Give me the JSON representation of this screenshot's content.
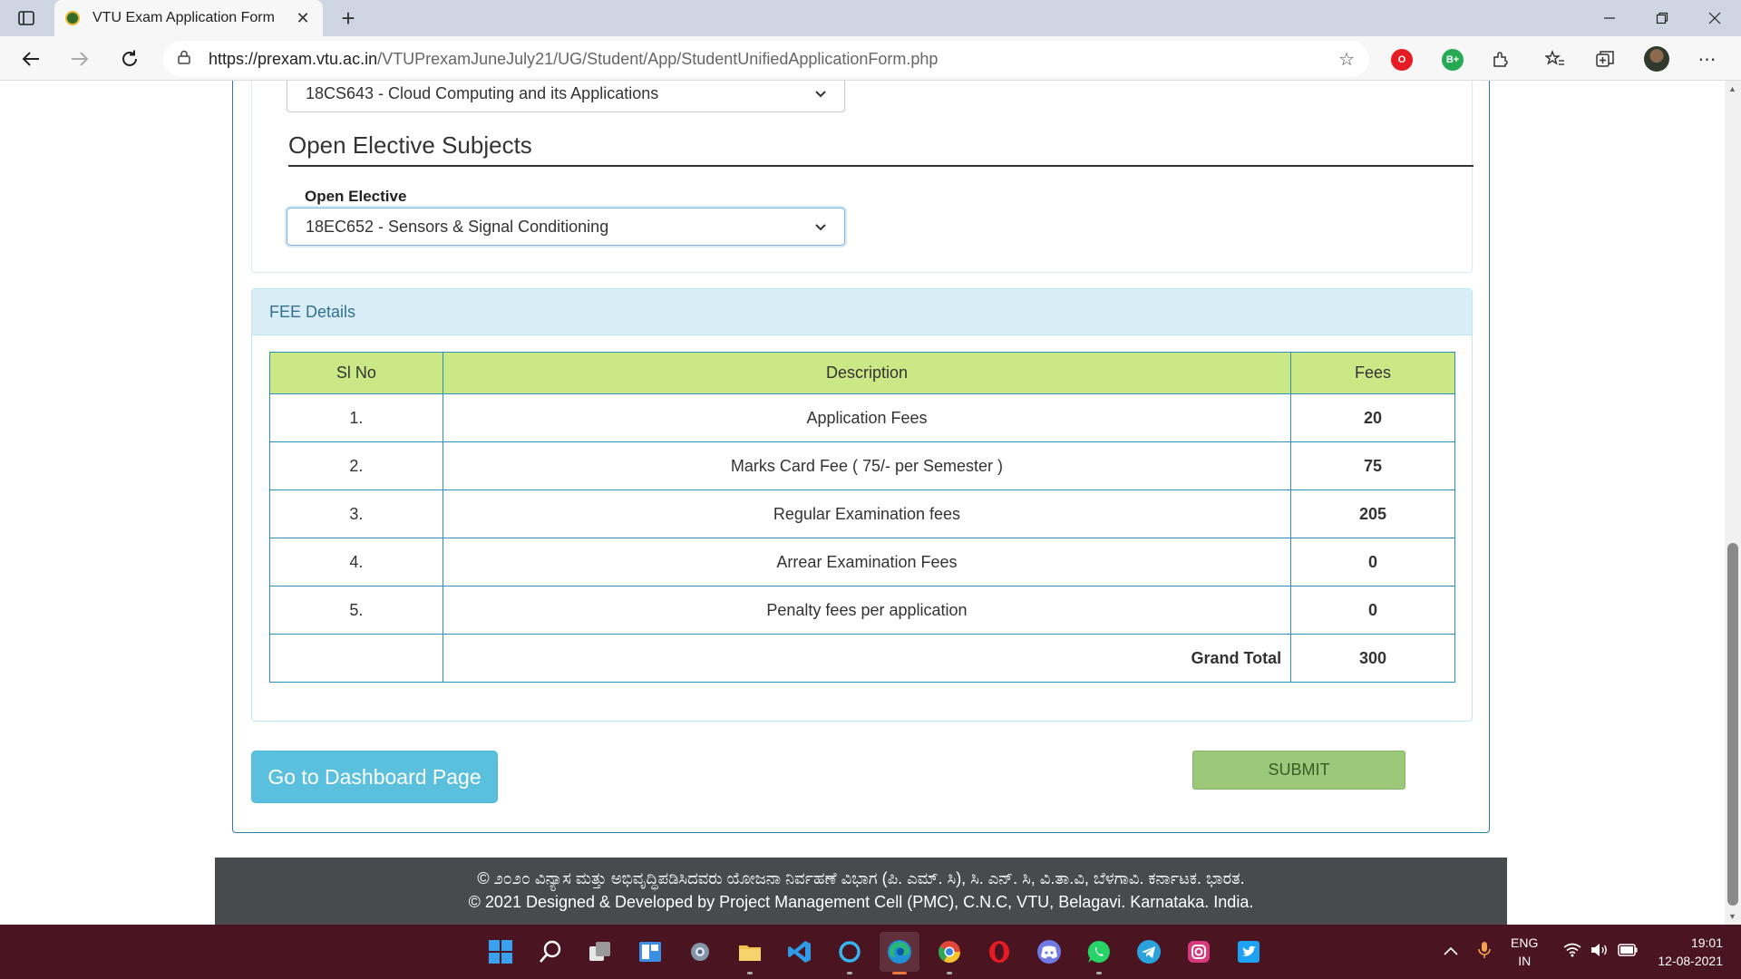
{
  "browser": {
    "tab_title": "VTU Exam Application Form",
    "tab_close": "✕",
    "new_tab": "+",
    "url_host": "https://prexam.vtu.ac.in",
    "url_path": "/VTUPrexamJuneJuly21/UG/Student/App/StudentUnifiedApplicationForm.php",
    "extensions": [
      {
        "name": "opera-extension",
        "label": "O",
        "color": "#e61b23"
      },
      {
        "name": "grammarly-extension",
        "label": "B+",
        "color": "#26a954"
      }
    ]
  },
  "form": {
    "elective_select_value": "18CS643 - Cloud Computing and its Applications",
    "open_elective_heading": "Open Elective Subjects",
    "open_elective_label": "Open Elective",
    "open_elective_value": "18EC652 - Sensors & Signal Conditioning"
  },
  "fees": {
    "panel_title": "FEE Details",
    "headers": {
      "sl": "Sl No",
      "description": "Description",
      "fees": "Fees"
    },
    "rows": [
      {
        "sl": "1.",
        "description": "Application Fees",
        "fee": "20"
      },
      {
        "sl": "2.",
        "description": "Marks Card Fee ( 75/- per Semester )",
        "fee": "75"
      },
      {
        "sl": "3.",
        "description": "Regular Examination fees",
        "fee": "205"
      },
      {
        "sl": "4.",
        "description": "Arrear Examination Fees",
        "fee": "0"
      },
      {
        "sl": "5.",
        "description": "Penalty fees per application",
        "fee": "0"
      }
    ],
    "grand_total_label": "Grand Total",
    "grand_total": "300"
  },
  "buttons": {
    "dashboard": "Go to Dashboard Page",
    "submit": "SUBMIT"
  },
  "footer": {
    "line1": "© ೨೦೨೦ ವಿನ್ಯಾಸ ಮತ್ತು ಅಭಿವೃದ್ಧಿಪಡಿಸಿದವರು ಯೋಜನಾ ನಿರ್ವಹಣೆ ವಿಭಾಗ (ಪಿ. ಎಮ್. ಸಿ), ಸಿ. ಎನ್. ಸಿ, ವಿ.ತಾ.ವಿ, ಬೆಳಗಾವಿ. ಕರ್ನಾಟಕ. ಭಾರತ.",
    "line2": "© 2021 Designed & Developed by Project Management Cell (PMC), C.N.C, VTU, Belagavi. Karnataka. India."
  },
  "taskbar": {
    "apps": [
      {
        "name": "start-icon",
        "color": "#3aa0f0"
      },
      {
        "name": "search-icon",
        "color": "#ffffff"
      },
      {
        "name": "task-view-icon",
        "color": "#dddddd"
      },
      {
        "name": "widgets-icon",
        "color": "#3a8ee6"
      },
      {
        "name": "settings-icon",
        "color": "#9aa7b5"
      },
      {
        "name": "file-explorer-icon",
        "color": "#f2c14e"
      },
      {
        "name": "vscode-icon",
        "color": "#2f9be6"
      },
      {
        "name": "cortana-icon",
        "color": "#35b6f2"
      },
      {
        "name": "edge-icon",
        "color": "#2bb673"
      },
      {
        "name": "chrome-icon",
        "color": "#e2463a"
      },
      {
        "name": "opera-icon",
        "color": "#e61b23"
      },
      {
        "name": "discord-icon",
        "color": "#6f7ae6"
      },
      {
        "name": "whatsapp-icon",
        "color": "#25d366"
      },
      {
        "name": "telegram-icon",
        "color": "#2aa3dd"
      },
      {
        "name": "instagram-icon",
        "color": "#d6397c"
      },
      {
        "name": "twitter-icon",
        "color": "#1da1f2"
      }
    ],
    "lang_1": "ENG",
    "lang_2": "IN",
    "time": "19:01",
    "date": "12-08-2021"
  }
}
